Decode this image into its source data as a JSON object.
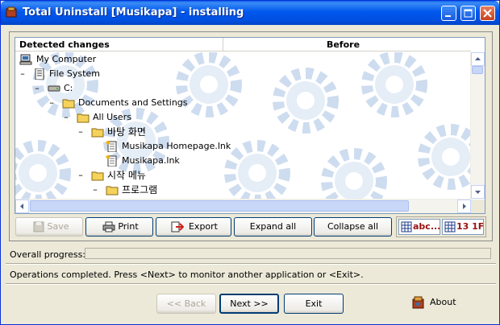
{
  "window": {
    "title": "Total Uninstall [Musikapa] - installing"
  },
  "tree": {
    "columns": [
      "Detected changes",
      "Before"
    ],
    "rows": [
      {
        "label": "My Computer",
        "icon": "computer-icon",
        "expander": ""
      },
      {
        "label": "File System",
        "icon": "file-system-icon",
        "expander": "–"
      },
      {
        "label": "C:",
        "icon": "drive-icon",
        "expander": "–"
      },
      {
        "label": "Documents and Settings",
        "icon": "folder-icon",
        "expander": "–"
      },
      {
        "label": "All Users",
        "icon": "folder-icon",
        "expander": "–"
      },
      {
        "label": "바탕 화면",
        "icon": "folder-icon",
        "expander": "–"
      },
      {
        "label": "Musikapa Homepage.lnk",
        "icon": "new-file-icon",
        "expander": ""
      },
      {
        "label": "Musikapa.lnk",
        "icon": "new-file-icon",
        "expander": ""
      },
      {
        "label": "시작 메뉴",
        "icon": "folder-icon",
        "expander": "–"
      },
      {
        "label": "프로그램",
        "icon": "folder-icon",
        "expander": "–"
      }
    ]
  },
  "toolbar": {
    "save": "Save",
    "print": "Print",
    "export": "Export",
    "expand_all": "Expand all",
    "collapse_all": "Collapse all",
    "view_text": "abc...",
    "view_hex": "13 1F..."
  },
  "progress": {
    "label": "Overall progress:",
    "value": 0
  },
  "status": "Operations completed. Press <Next> to monitor another application or <Exit>.",
  "footer": {
    "back": "<< Back",
    "next": "Next >>",
    "exit": "Exit",
    "about": "About"
  },
  "colors": {
    "titlebar": "#0058EE",
    "window_bg": "#ECE9D8",
    "folder": "#F5D25B"
  }
}
